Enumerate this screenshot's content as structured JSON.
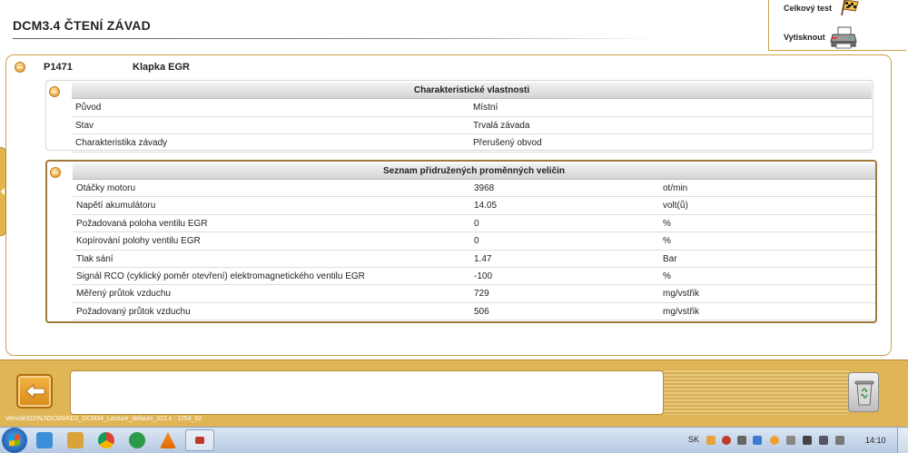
{
  "header": {
    "title": "DCM3.4  ČTENÍ ZÁVAD",
    "actions": {
      "full_test_label": "Celkový test",
      "print_label": "Vytisknout"
    }
  },
  "fault": {
    "code": "P1471",
    "name": "Klapka EGR"
  },
  "properties": {
    "title": "Charakteristické vlastnosti",
    "rows": [
      {
        "label": "Původ",
        "value": "Místní"
      },
      {
        "label": "Stav",
        "value": "Trvalá závada"
      },
      {
        "label": "Charakteristika závady",
        "value": "Přerušený obvod"
      }
    ]
  },
  "variables": {
    "title": "Seznam přidružených proměnných veličin",
    "rows": [
      {
        "label": "Otáčky motoru",
        "value": "3968",
        "unit": "ot/min"
      },
      {
        "label": "Napětí akumulátoru",
        "value": "14.05",
        "unit": "volt(ů)"
      },
      {
        "label": "Požadovaná poloha ventilu EGR",
        "value": "0",
        "unit": "%"
      },
      {
        "label": "Kopírování polohy ventilu EGR",
        "value": "0",
        "unit": "%"
      },
      {
        "label": "Tlak sání",
        "value": "1.47",
        "unit": "Bar"
      },
      {
        "label": "Signál RCO (cyklický poměr otevření) elektromagnetického ventilu EGR",
        "value": "-100",
        "unit": "%"
      },
      {
        "label": "Měřený průtok vzduchu",
        "value": "729",
        "unit": "mg/vstřik"
      },
      {
        "label": "Požadovaný průtok vzduchu",
        "value": "506",
        "unit": "mg/vstřik"
      }
    ]
  },
  "bottom": {
    "message": "",
    "path": "Vehicle\\D2\\NJ\\DCM34\\D2_DCM34_Lecture_defauts_312.s : 1254_02"
  },
  "taskbar": {
    "language": "SK",
    "clock": "14:10"
  },
  "colors": {
    "accent": "#e0b556",
    "border_gold": "#c9a24a",
    "table_frame": "#a07a3a"
  }
}
